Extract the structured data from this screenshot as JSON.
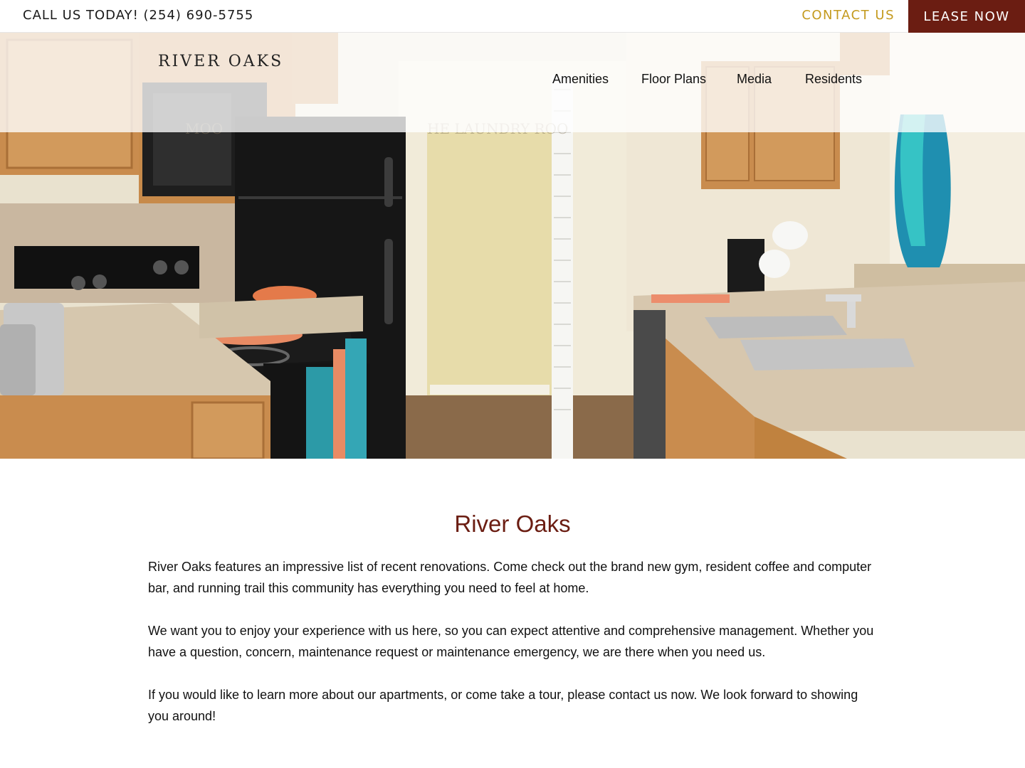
{
  "topbar": {
    "call_text": "CALL US TODAY! (254) 690-5755",
    "contact_label": "CONTACT US",
    "lease_label": "LEASE NOW",
    "contact_color": "#c49a1e",
    "lease_bg": "#6b1d12"
  },
  "header": {
    "logo_text": "RIVER OAKS",
    "nav": [
      {
        "label": "Amenities"
      },
      {
        "label": "Floor Plans"
      },
      {
        "label": "Media"
      },
      {
        "label": "Residents"
      }
    ]
  },
  "hero": {
    "sign_left": "MOO",
    "sign_right": "HE LAUNDRY ROO"
  },
  "main": {
    "title": "River Oaks",
    "title_color": "#6b1d12",
    "paragraphs": [
      "River Oaks features an impressive list of recent renovations. Come check out the brand new gym, resident coffee and computer bar, and running trail this community has everything you need to feel at home.",
      "We want you to enjoy your experience with us here, so you can expect attentive and comprehensive management. Whether you have a question, concern, maintenance request or maintenance emergency, we are there when you need us.",
      "If you would like to learn more about our apartments, or come take a tour, please contact us now. We look forward to showing you around!"
    ]
  }
}
